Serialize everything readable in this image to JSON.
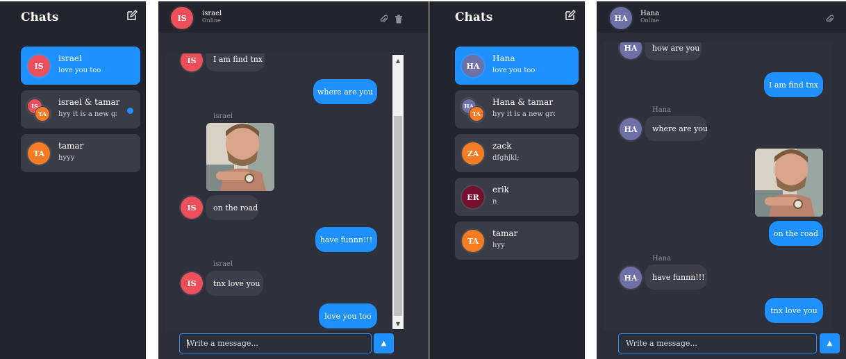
{
  "colors": {
    "accent": "#1e90ff",
    "sidebar": "#22252e",
    "pane": "#2b2e38",
    "bubble_in": "#3c3f4a"
  },
  "left_sidebar": {
    "title": "Chats",
    "items": [
      {
        "name": "israel",
        "last": "love you too",
        "avatar": "IS",
        "active": true
      },
      {
        "name": "israel & tamar",
        "last": "hyy it is a new grou",
        "avatars": [
          "IS",
          "TA"
        ],
        "unread": true
      },
      {
        "name": "tamar",
        "last": "hyyy",
        "avatar": "TA"
      }
    ]
  },
  "left_chat": {
    "header": {
      "avatar": "IS",
      "name": "israel",
      "status": "Online"
    },
    "messages": [
      {
        "dir": "in",
        "avatar": "IS",
        "text": "I am find tnx"
      },
      {
        "dir": "out",
        "text": "where are you"
      },
      {
        "dir": "in",
        "sender": "israel",
        "image": "photo-of-man"
      },
      {
        "dir": "in",
        "avatar": "IS",
        "text": "on the road"
      },
      {
        "dir": "out",
        "text": "have funnn!!!"
      },
      {
        "dir": "in",
        "sender": "israel",
        "avatar": "IS",
        "text": "tnx love you"
      },
      {
        "dir": "out",
        "text": "love you too"
      }
    ],
    "input_placeholder": "Write a message..."
  },
  "right_sidebar": {
    "title": "Chats",
    "items": [
      {
        "name": "Hana",
        "last": "love you too",
        "avatar": "HA",
        "active": true
      },
      {
        "name": "Hana & tamar",
        "last": "hyy it is a new grou",
        "avatars": [
          "HA",
          "TA"
        ]
      },
      {
        "name": "zack",
        "last": "dfghjkl;",
        "avatar": "ZA"
      },
      {
        "name": "erik",
        "last": "n",
        "avatar": "ER"
      },
      {
        "name": "tamar",
        "last": "hyy",
        "avatar": "TA"
      }
    ]
  },
  "right_chat": {
    "header": {
      "avatar": "HA",
      "name": "Hana",
      "status": "Online"
    },
    "messages": [
      {
        "dir": "in",
        "avatar": "HA",
        "text": "how are you"
      },
      {
        "dir": "out",
        "text": "I am find tnx"
      },
      {
        "dir": "in",
        "sender": "Hana",
        "avatar": "HA",
        "text": "where are you"
      },
      {
        "dir": "out",
        "image": "photo-of-man"
      },
      {
        "dir": "out",
        "text": "on the road"
      },
      {
        "dir": "in",
        "sender": "Hana",
        "avatar": "HA",
        "text": "have funnn!!!"
      },
      {
        "dir": "out",
        "text": "tnx love you"
      }
    ],
    "input_placeholder": "Write a message..."
  }
}
